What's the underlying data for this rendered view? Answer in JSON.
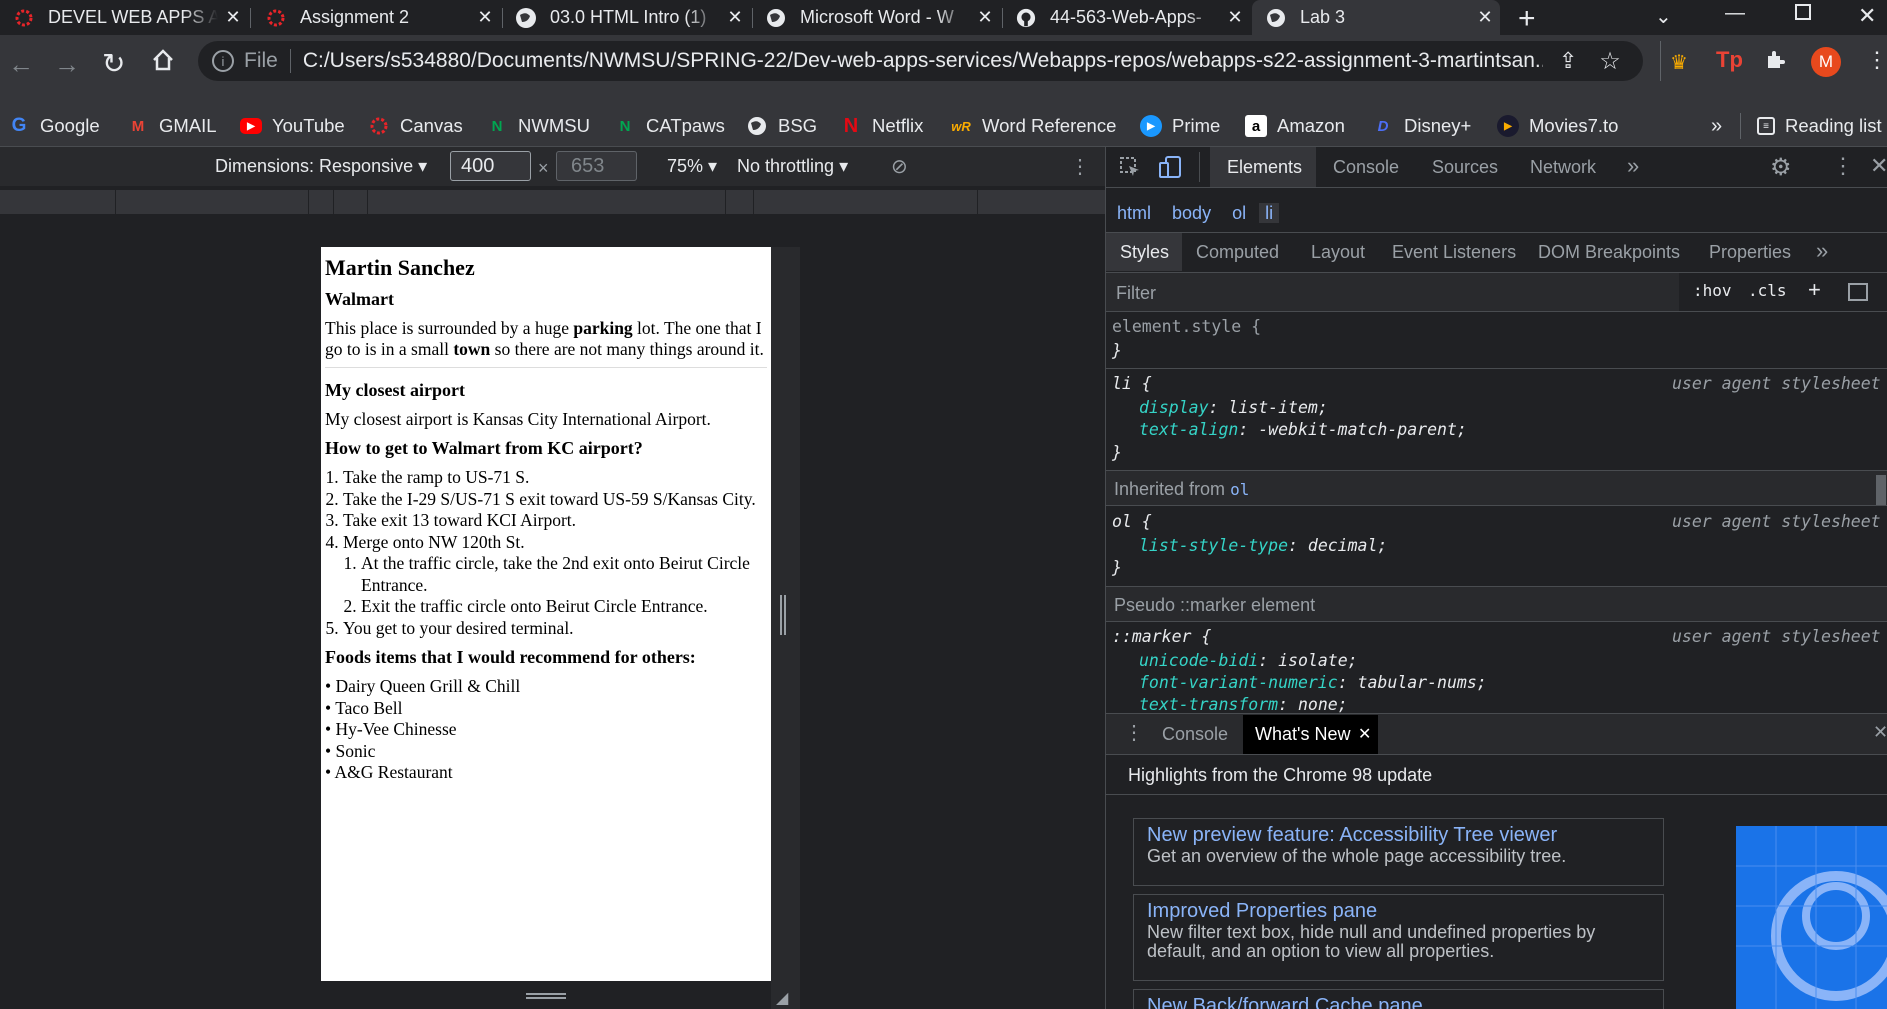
{
  "tabs": [
    {
      "title": "DEVEL WEB APPS A",
      "icon": "canvas-icon",
      "color": "#e72429"
    },
    {
      "title": "Assignment 2",
      "icon": "canvas-icon",
      "color": "#e72429"
    },
    {
      "title": "03.0 HTML Intro (1)",
      "icon": "globe-icon",
      "color": "#e8eaed"
    },
    {
      "title": "Microsoft Word - W",
      "icon": "globe-icon",
      "color": "#e8eaed"
    },
    {
      "title": "44-563-Web-Apps-",
      "icon": "github-icon",
      "color": "#e8eaed"
    },
    {
      "title": "Lab 3",
      "icon": "globe-icon",
      "color": "#e8eaed"
    }
  ],
  "omnibox": {
    "scheme_label": "File",
    "url": "C:/Users/s534880/Documents/NWMSU/SPRING-22/Dev-web-apps-services/Webapps-repos/webapps-s22-assignment-3-martintsan..."
  },
  "profile_initial": "M",
  "bookmarks": [
    {
      "label": "Google",
      "icon": "google-icon"
    },
    {
      "label": "GMAIL",
      "icon": "gmail-icon"
    },
    {
      "label": "YouTube",
      "icon": "youtube-icon"
    },
    {
      "label": "Canvas",
      "icon": "canvas-icon"
    },
    {
      "label": "NWMSU",
      "icon": "nwmsu-icon"
    },
    {
      "label": "CATpaws",
      "icon": "nwmsu-icon"
    },
    {
      "label": "BSG",
      "icon": "globe-icon"
    },
    {
      "label": "Netflix",
      "icon": "netflix-icon"
    },
    {
      "label": "Word Reference",
      "icon": "wordreference-icon"
    },
    {
      "label": "Prime",
      "icon": "prime-icon"
    },
    {
      "label": "Amazon",
      "icon": "amazon-icon"
    },
    {
      "label": "Disney+",
      "icon": "disney-icon"
    },
    {
      "label": "Movies7.to",
      "icon": "movies-icon"
    }
  ],
  "overflow_label": "»",
  "reading_list": "Reading list",
  "device_toolbar": {
    "dimensions": "Dimensions: Responsive",
    "width": "400",
    "height": "653",
    "times": "×",
    "zoom": "75%",
    "throttling": "No throttling"
  },
  "page": {
    "name": "Martin Sanchez",
    "walmart_heading": "Walmart",
    "walmart_text_1": "This place is surrounded by a huge ",
    "walmart_bold_1": "parking",
    "walmart_text_2": " lot. The one that I go to is in a small ",
    "walmart_bold_2": "town",
    "walmart_text_3": " so there are not many things around it.",
    "airport_heading": "My closest airport",
    "airport_text": "My closest airport is Kansas City International Airport.",
    "directions_heading": "How to get to Walmart from KC airport?",
    "directions": [
      "Take the ramp to US-71 S.",
      "Take the I-29 S/US-71 S exit toward US-59 S/Kansas City.",
      "Take exit 13 toward KCI Airport.",
      "Merge onto NW 120th St."
    ],
    "sub_directions": [
      "At the traffic circle, take the 2nd exit onto Beirut Circle Entrance.",
      "Exit the traffic circle onto Beirut Circle Entrance."
    ],
    "final_direction": "You get to your desired terminal.",
    "foods_heading": "Foods items that I would recommend for others:",
    "foods": [
      "Dairy Queen Grill & Chill",
      "Taco Bell",
      "Hy-Vee Chinesse",
      "Sonic",
      "A&G Restaurant"
    ]
  },
  "devtools": {
    "tabs": [
      "Elements",
      "Console",
      "Sources",
      "Network"
    ],
    "more": "»",
    "breadcrumb": [
      "html",
      "body",
      "ol",
      "li"
    ],
    "subtabs": [
      "Styles",
      "Computed",
      "Layout",
      "Event Listeners",
      "DOM Breakpoints",
      "Properties"
    ],
    "filter_placeholder": "Filter",
    "hov": ":hov",
    "cls": ".cls",
    "element_style": "element.style {",
    "close_brace": "}",
    "li_selector": "li {",
    "li_prop1": "display",
    "li_val1": ": list-item;",
    "li_prop2": "text-align",
    "li_val2": ": -webkit-match-parent;",
    "ua_label": "user agent stylesheet",
    "inherited_label": "Inherited from",
    "inherited_from": "ol",
    "ol_selector": "ol {",
    "ol_prop": "list-style-type",
    "ol_val": ": decimal;",
    "pseudo_label": "Pseudo ::marker element",
    "marker_selector": "::marker {",
    "marker_prop1": "unicode-bidi",
    "marker_val1": ": isolate;",
    "marker_prop2": "font-variant-numeric",
    "marker_val2": ": tabular-nums;",
    "marker_prop3": "text-transform",
    "marker_val3": ": none;",
    "drawer_console": "Console",
    "drawer_whatsnew": "What's New",
    "highlights": "Highlights from the Chrome 98 update",
    "cards": [
      {
        "title": "New preview feature: Accessibility Tree viewer",
        "desc": "Get an overview of the whole page accessibility tree."
      },
      {
        "title": "Improved Properties pane",
        "desc": "New filter text box, hide null and undefined properties by default, and an option to view all properties."
      },
      {
        "title": "New Back/forward Cache pane",
        "desc": ""
      }
    ]
  }
}
